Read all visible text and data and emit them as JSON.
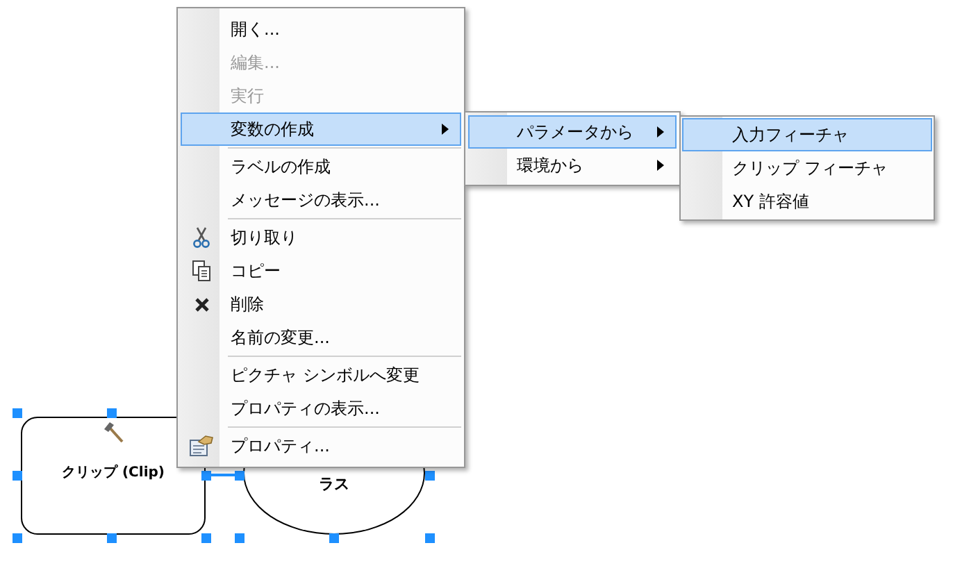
{
  "diagram": {
    "nodes": [
      {
        "kind": "tool",
        "label": "クリップ (Clip)",
        "selected": true
      },
      {
        "kind": "data",
        "label": "ラス",
        "selected": true
      }
    ]
  },
  "context_menu": {
    "items": [
      {
        "kind": "item",
        "label": "開く...",
        "disabled": false,
        "selected": false,
        "submenu": false
      },
      {
        "kind": "item",
        "label": "編集...",
        "disabled": true,
        "selected": false,
        "submenu": false
      },
      {
        "kind": "item",
        "label": "実行",
        "disabled": true,
        "selected": false,
        "submenu": false
      },
      {
        "kind": "item",
        "label": "変数の作成",
        "disabled": false,
        "selected": true,
        "submenu": true
      },
      {
        "kind": "separator"
      },
      {
        "kind": "item",
        "label": "ラベルの作成",
        "disabled": false,
        "selected": false,
        "submenu": false
      },
      {
        "kind": "item",
        "label": "メッセージの表示...",
        "disabled": false,
        "selected": false,
        "submenu": false
      },
      {
        "kind": "separator"
      },
      {
        "kind": "item",
        "label": "切り取り",
        "disabled": false,
        "selected": false,
        "submenu": false
      },
      {
        "kind": "item",
        "label": "コピー",
        "disabled": false,
        "selected": false,
        "submenu": false
      },
      {
        "kind": "item",
        "label": "削除",
        "disabled": false,
        "selected": false,
        "submenu": false
      },
      {
        "kind": "item",
        "label": "名前の変更...",
        "disabled": false,
        "selected": false,
        "submenu": false
      },
      {
        "kind": "separator"
      },
      {
        "kind": "item",
        "label": "ピクチャ シンボルへ変更",
        "disabled": false,
        "selected": false,
        "submenu": false
      },
      {
        "kind": "item",
        "label": "プロパティの表示...",
        "disabled": false,
        "selected": false,
        "submenu": false
      },
      {
        "kind": "separator"
      },
      {
        "kind": "item",
        "label": "プロパティ...",
        "disabled": false,
        "selected": false,
        "submenu": false
      }
    ]
  },
  "submenu": {
    "items": [
      {
        "label": "パラメータから",
        "selected": true,
        "submenu": true
      },
      {
        "label": "環境から",
        "selected": false,
        "submenu": true
      }
    ]
  },
  "sub_submenu": {
    "items": [
      {
        "label": "入力フィーチャ",
        "selected": true
      },
      {
        "label": "クリップ フィーチャ",
        "selected": false
      },
      {
        "label": "XY 許容値",
        "selected": false
      }
    ]
  }
}
